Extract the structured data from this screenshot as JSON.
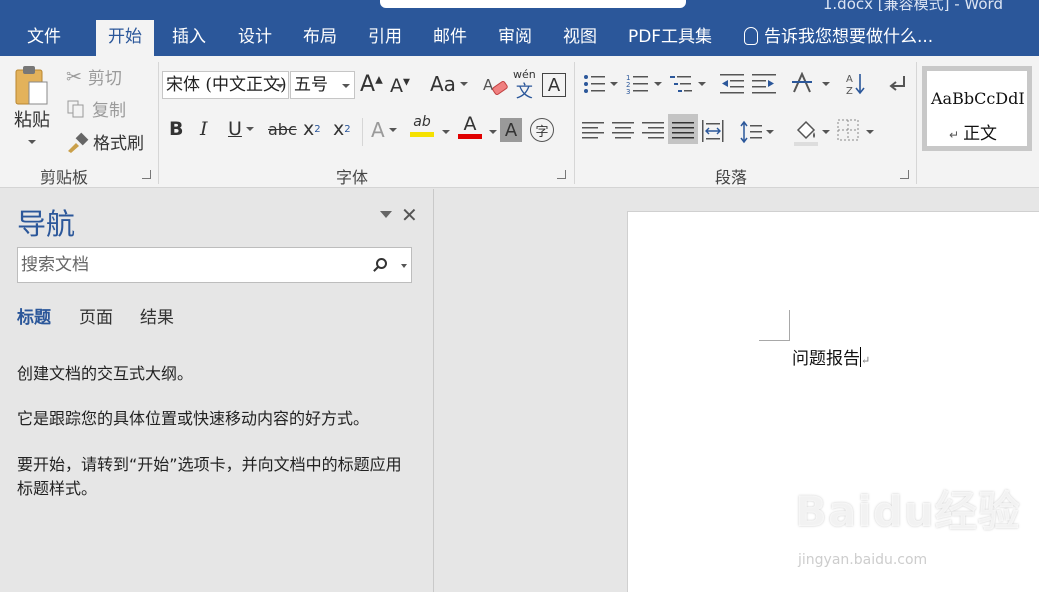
{
  "titlebar": {
    "title": "1.docx [兼容模式] - Word"
  },
  "tabs": [
    {
      "label": "文件"
    },
    {
      "label": "开始"
    },
    {
      "label": "插入"
    },
    {
      "label": "设计"
    },
    {
      "label": "布局"
    },
    {
      "label": "引用"
    },
    {
      "label": "邮件"
    },
    {
      "label": "审阅"
    },
    {
      "label": "视图"
    },
    {
      "label": "PDF工具集"
    }
  ],
  "tell_me": "告诉我您想要做什么...",
  "clipboard": {
    "paste": "粘贴",
    "cut": "剪切",
    "copy": "复制",
    "format_painter": "格式刷",
    "group": "剪贴板"
  },
  "font": {
    "name": "宋体 (中文正文)",
    "size": "五号",
    "change_case": "Aa",
    "phonetic_top": "wén",
    "phonetic_bottom": "文",
    "char_border": "A",
    "bold": "B",
    "italic": "I",
    "underline": "U",
    "strike": "abc",
    "subscript": "x",
    "subscript_mark": "2",
    "superscript": "x",
    "superscript_mark": "2",
    "text_effects": "A",
    "highlight": "ab",
    "font_color": "A",
    "char_shading": "A",
    "enclose": "字",
    "group": "字体",
    "highlight_color": "#f5e100",
    "font_color_value": "#e00000"
  },
  "paragraph": {
    "group": "段落"
  },
  "styles": {
    "sample": "AaBbCcDdI",
    "name": "正文",
    "name_mark": "↵"
  },
  "nav": {
    "title": "导航",
    "search_placeholder": "搜索文档",
    "tabs": [
      {
        "label": "标题"
      },
      {
        "label": "页面"
      },
      {
        "label": "结果"
      }
    ],
    "texts": [
      "创建文档的交互式大纲。",
      "它是跟踪您的具体位置或快速移动内容的好方式。",
      "要开始，请转到“开始”选项卡，并向文档中的标题应用标题样式。"
    ]
  },
  "document": {
    "text": "问题报告",
    "para_mark": "↵"
  },
  "watermark": {
    "brand": "Baidu经验",
    "url": "jingyan.baidu.com"
  },
  "colors": {
    "accent": "#2b579a",
    "ribbon": "#f3f3f3",
    "pane": "#e6e6e6"
  }
}
